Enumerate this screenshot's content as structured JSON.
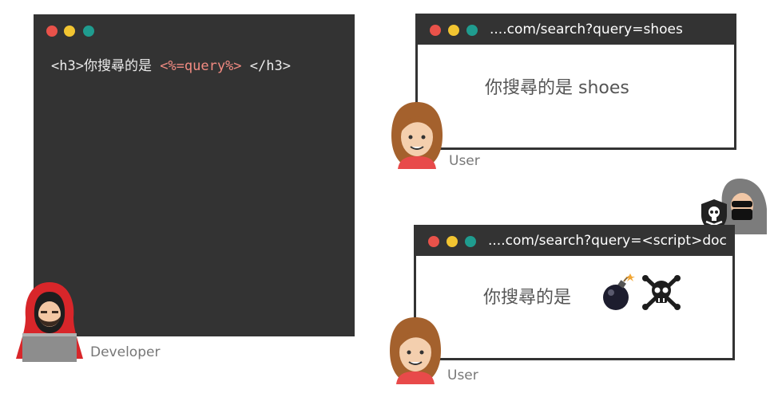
{
  "developer": {
    "code_prefix": "<h3>你搜尋的是 ",
    "code_highlight": "<%=query%>",
    "code_suffix": " </h3>",
    "label": "Developer",
    "avatar_icon": "hooded-developer-icon"
  },
  "user_browser": {
    "url": "....com/search?query=shoes",
    "text": "你搜尋的是 shoes",
    "user_label": "User"
  },
  "attack_browser": {
    "url": "....com/search?query=<script>doc",
    "text": "你搜尋的是",
    "icons": [
      "bomb-icon",
      "skull-crossbones-icon"
    ],
    "user_label": "User"
  },
  "hacker": {
    "icon": "hacker-icon",
    "shield_icon": "shield-skull-icon"
  },
  "colors": {
    "window_dark": "#333333",
    "code_highlight": "#f28b82",
    "dot_red": "#e9524a",
    "dot_yellow": "#f2c531",
    "dot_teal": "#1f9c8f"
  }
}
